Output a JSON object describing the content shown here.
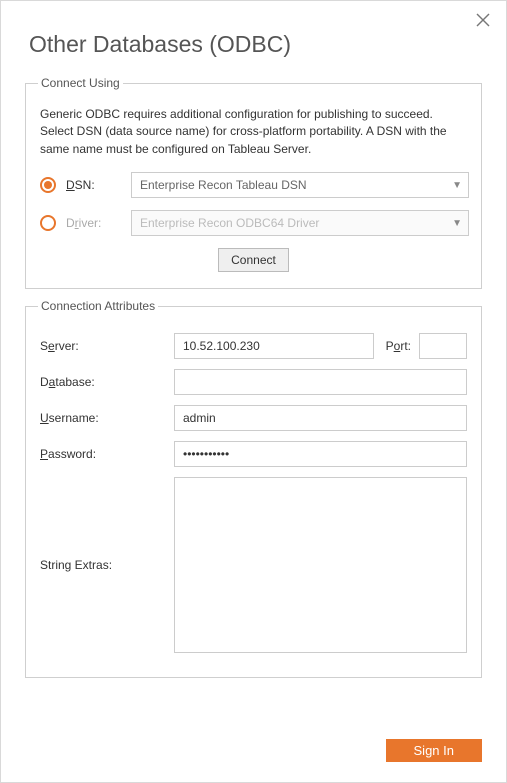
{
  "title": "Other Databases (ODBC)",
  "close_icon": "close",
  "connect_using": {
    "legend": "Connect Using",
    "description": "Generic ODBC requires additional configuration for publishing to succeed. Select DSN (data source name) for cross-platform portability. A DSN with the same name must be configured on Tableau Server.",
    "dsn_label": "DSN:",
    "dsn_dropdown": "Enterprise Recon Tableau DSN",
    "driver_label": "Driver:",
    "driver_dropdown": "Enterprise Recon ODBC64 Driver",
    "connect_button": "Connect"
  },
  "connection_attrs": {
    "legend": "Connection Attributes",
    "server_label": "Server:",
    "server_value": "10.52.100.230",
    "port_label": "Port:",
    "port_value": "",
    "database_label": "Database:",
    "database_value": "",
    "username_label": "Username:",
    "username_value": "admin",
    "password_label": "Password:",
    "password_value": "•••••••••••",
    "string_extras_label": "String Extras:",
    "string_extras_value": ""
  },
  "signin_button": "Sign In"
}
